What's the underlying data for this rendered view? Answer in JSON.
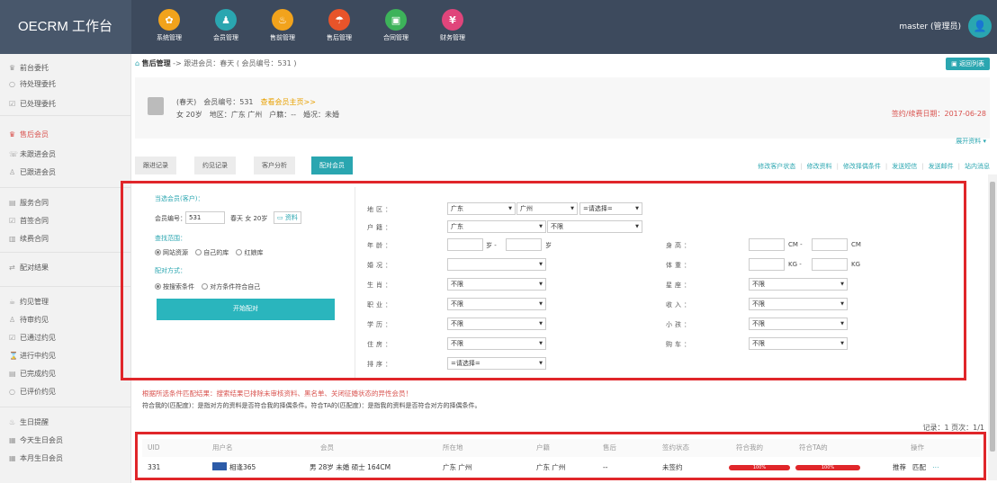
{
  "app": {
    "title": "OECRM 工作台"
  },
  "modules": [
    {
      "label": "系统管理",
      "icon": "gear-icon",
      "color": "#f2a31c",
      "glyph": "✿"
    },
    {
      "label": "会员管理",
      "icon": "members-icon",
      "color": "#2aa6b0",
      "glyph": "♟"
    },
    {
      "label": "售前管理",
      "icon": "fire-icon",
      "color": "#f2a31c",
      "glyph": "♨"
    },
    {
      "label": "售后管理",
      "icon": "umbrella-icon",
      "color": "#e8542a",
      "glyph": "☂"
    },
    {
      "label": "合同管理",
      "icon": "contract-icon",
      "color": "#3db35a",
      "glyph": "▣"
    },
    {
      "label": "财务管理",
      "icon": "finance-icon",
      "color": "#e0457b",
      "glyph": "¥"
    }
  ],
  "user": {
    "label": "master (管理员)"
  },
  "sidebar": {
    "items": [
      {
        "label": "前台委托",
        "icon": "delegate-icon"
      },
      {
        "label": "待处理委托",
        "icon": "pending-icon"
      },
      {
        "label": "已处理委托",
        "icon": "done-icon"
      },
      {
        "label": "售后会员",
        "icon": "members-icon"
      },
      {
        "label": "未跟进会员",
        "icon": "phone-icon"
      },
      {
        "label": "已跟进会员",
        "icon": "user-icon"
      },
      {
        "label": "服务合同",
        "icon": "doc-icon"
      },
      {
        "label": "首签合同",
        "icon": "sign-icon"
      },
      {
        "label": "续费合同",
        "icon": "renew-icon"
      },
      {
        "label": "配对结果",
        "icon": "match-icon"
      },
      {
        "label": "约见管理",
        "icon": "coffee-icon"
      },
      {
        "label": "待审约见",
        "icon": "user-icon"
      },
      {
        "label": "已通过约见",
        "icon": "check-icon"
      },
      {
        "label": "进行中约见",
        "icon": "hourglass-icon"
      },
      {
        "label": "已完成约见",
        "icon": "done-icon"
      },
      {
        "label": "已评价约见",
        "icon": "rate-icon"
      },
      {
        "label": "生日提醒",
        "icon": "cake-icon"
      },
      {
        "label": "今天生日会员",
        "icon": "calendar-icon"
      },
      {
        "label": "本月生日会员",
        "icon": "calendar-icon"
      }
    ]
  },
  "breadcrumb": {
    "section": "售后管理",
    "rest": " -> 跟进会员：春天 ( 会员编号：531 )"
  },
  "back_button": "返回列表",
  "member": {
    "line1": "(春天)　会员编号：531",
    "link": "查看会员主页>>",
    "line2": "女 20岁　地区：广东 广州　户籍：--　婚况：未婚",
    "expiry": "签约/续费日期：2017-06-28",
    "expand": "展开资料 ▾"
  },
  "tabs": [
    "跟进记录",
    "约见记录",
    "客户分析",
    "配对会员"
  ],
  "actions": [
    "修改客户状态",
    "修改资料",
    "修改择偶条件",
    "发送短信",
    "发送邮件",
    "站内消息"
  ],
  "form": {
    "current_member_label": "当选会员(客户)：",
    "member_no_label": "会员编号：",
    "member_no": "531",
    "member_desc": "春天 女 20岁",
    "profile_link": "资料",
    "scope_label": "查找范围：",
    "scope_options": [
      "网站资源",
      "自己的库",
      "红娘库"
    ],
    "method_label": "配对方式：",
    "method_options": [
      "按搜索条件",
      "对方条件符合自己"
    ],
    "start_button": "开始配对",
    "fields": {
      "region": {
        "label": "地区：",
        "province": "广东",
        "city": "广州",
        "district": "=请选择="
      },
      "huji": {
        "label": "户籍：",
        "province": "广东",
        "city": "不限"
      },
      "age": {
        "label": "年龄：",
        "sep": "岁 -",
        "unit": "岁"
      },
      "marriage": {
        "label": "婚况：",
        "value": ""
      },
      "zodiac": {
        "label": "生肖：",
        "value": "不限"
      },
      "job": {
        "label": "职业：",
        "value": "不限"
      },
      "edu": {
        "label": "学历：",
        "value": "不限"
      },
      "house": {
        "label": "住房：",
        "value": "不限"
      },
      "sort": {
        "label": "排序：",
        "value": "=请选择="
      },
      "height": {
        "label": "身高：",
        "sep": "CM -",
        "unit": "CM"
      },
      "weight": {
        "label": "体重：",
        "sep": "KG -",
        "unit": "KG"
      },
      "star": {
        "label": "星座：",
        "value": "不限"
      },
      "income": {
        "label": "收入：",
        "value": "不限"
      },
      "kids": {
        "label": "小孩：",
        "value": "不限"
      },
      "car": {
        "label": "购车：",
        "value": "不限"
      }
    }
  },
  "notice": {
    "line1": "根据所选条件匹配结果：搜索结果已排除未审核资料、黑名单、关闭征婚状态的异性会员！",
    "line2": "符合我的(匹配度)：是指对方的资料是否符合我的择偶条件。符合TA的(匹配度)：是指我的资料是否符合对方的择偶条件。"
  },
  "records": "记录：1  页次：1/1",
  "table": {
    "headers": [
      "UID",
      "用户名",
      "会员",
      "所在地",
      "户籍",
      "售后",
      "签约状态",
      "符合我的",
      "符合TA的",
      "操作"
    ],
    "rows": [
      {
        "uid": "331",
        "username": "相逢365",
        "member": "男 28岁 未婚 硕士 164CM",
        "location": "广东 广州",
        "huji": "广东 广州",
        "aftersale": "--",
        "status": "未签约",
        "match_me": "100%",
        "match_me_value": 100,
        "match_ta": "100%",
        "match_ta_value": 100,
        "op1": "推荐",
        "op2": "匹配",
        "op3": "⋯"
      }
    ]
  }
}
